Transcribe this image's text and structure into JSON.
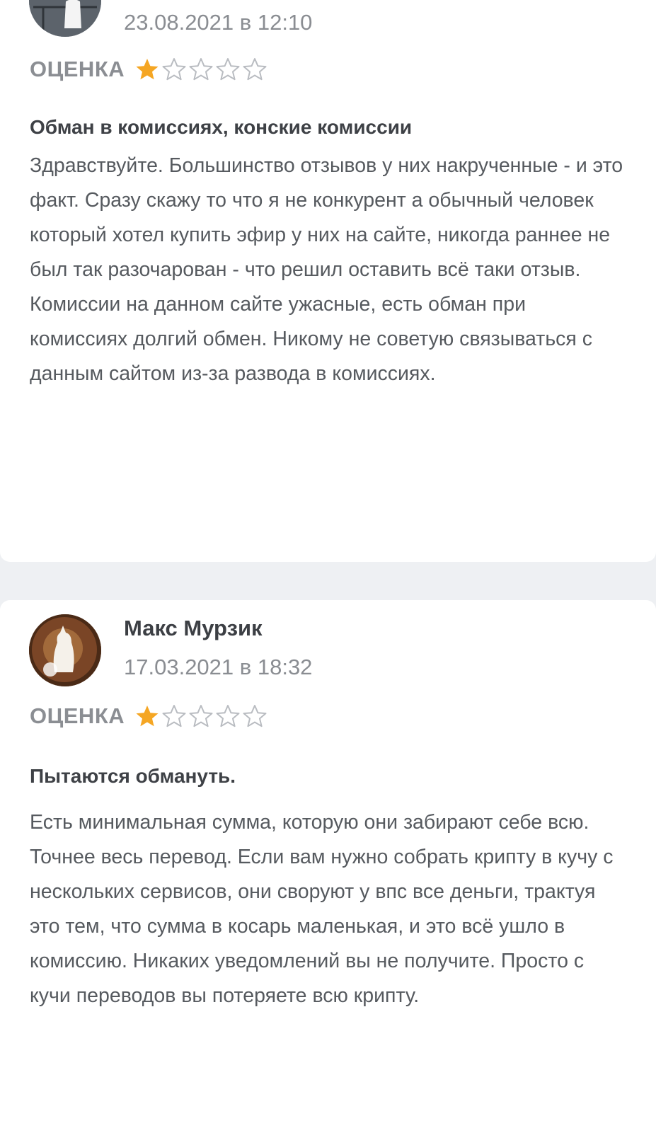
{
  "reviews": [
    {
      "author": "",
      "date": "23.08.2021 в 12:10",
      "rating_label": "ОЦЕНКА",
      "rating": 1,
      "rating_max": 5,
      "title": "Обман в комиссиях, конские комиссии",
      "body": "Здравствуйте. Большинство отзывов у них накрученные - и это факт. Сразу скажу то что я не конкурент а обычный человек который хотел купить эфир у них на сайте, никогда раннее не был так разочарован - что решил оставить всё таки отзыв. Комиссии на данном сайте ужасные, есть обман при комиссиях долгий обмен. Никому не советую связываться с данным сайтом из-за развода в комиссиях."
    },
    {
      "author": "Макс Мурзик",
      "date": "17.03.2021 в 18:32",
      "rating_label": "ОЦЕНКА",
      "rating": 1,
      "rating_max": 5,
      "title": "Пытаются обмануть.",
      "body": "Есть минимальная сумма, которую они забирают себе всю. Точнее весь перевод. Если вам нужно собрать крипту в кучу с нескольких сервисов, они своруют у впс все деньги, трактуя это тем, что сумма в косарь маленькая, и это всё ушло в комиссию. Никаких уведомлений вы не получите. Просто с кучи переводов вы потеряете всю крипту."
    }
  ],
  "colors": {
    "star_filled": "#f5a623",
    "star_empty": "#b9bcc1",
    "page_bg": "#eef0f3",
    "card_bg": "#ffffff"
  },
  "icons": {
    "avatar_1": "avatar-photo",
    "avatar_2": "cat-avatar-photo",
    "star_filled": "star-filled-icon",
    "star_empty": "star-outline-icon"
  }
}
